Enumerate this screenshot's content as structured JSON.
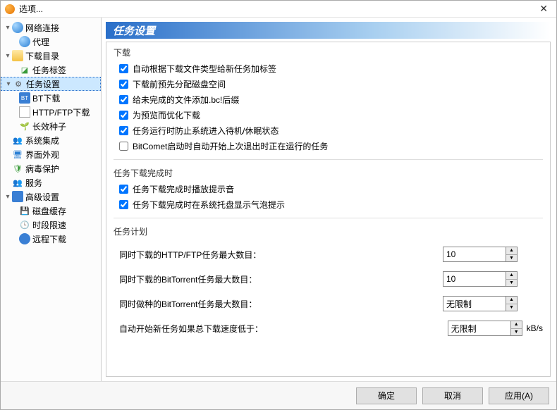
{
  "window": {
    "title": "选项..."
  },
  "sidebar": {
    "items": [
      {
        "label": "网络连接"
      },
      {
        "label": "代理"
      },
      {
        "label": "下载目录"
      },
      {
        "label": "任务标签"
      },
      {
        "label": "任务设置"
      },
      {
        "label": "BT下载"
      },
      {
        "label": "HTTP/FTP下载"
      },
      {
        "label": "长效种子"
      },
      {
        "label": "系统集成"
      },
      {
        "label": "界面外观"
      },
      {
        "label": "病毒保护"
      },
      {
        "label": "服务"
      },
      {
        "label": "高级设置"
      },
      {
        "label": "磁盘缓存"
      },
      {
        "label": "时段限速"
      },
      {
        "label": "远程下载"
      }
    ]
  },
  "panel": {
    "header": "任务设置",
    "group_download": "下载",
    "chk": {
      "auto_tag": "自动根据下载文件类型给新任务加标签",
      "prealloc": "下载前预先分配磁盘空间",
      "bci": "给未完成的文件添加.bc!后缀",
      "preview": "为预览而优化下载",
      "prevent_sleep": "任务运行时防止系统进入待机/休眠状态",
      "resume_on_start": "BitComet启动时自动开始上次退出时正在运行的任务"
    },
    "group_complete": "任务下载完成时",
    "chk2": {
      "play_sound": "任务下载完成时播放提示音",
      "balloon": "任务下载完成时在系统托盘显示气泡提示"
    },
    "group_plan": "任务计划",
    "plan": {
      "http_label": "同时下载的HTTP/FTP任务最大数目：",
      "http_value": "10",
      "bt_label": "同时下载的BitTorrent任务最大数目：",
      "bt_value": "10",
      "seed_label": "同时做种的BitTorrent任务最大数目：",
      "seed_value": "无限制",
      "autostart_label": "自动开始新任务如果总下载速度低于：",
      "autostart_value": "无限制",
      "autostart_unit": "kB/s"
    }
  },
  "footer": {
    "ok": "确定",
    "cancel": "取消",
    "apply": "应用(A)"
  }
}
